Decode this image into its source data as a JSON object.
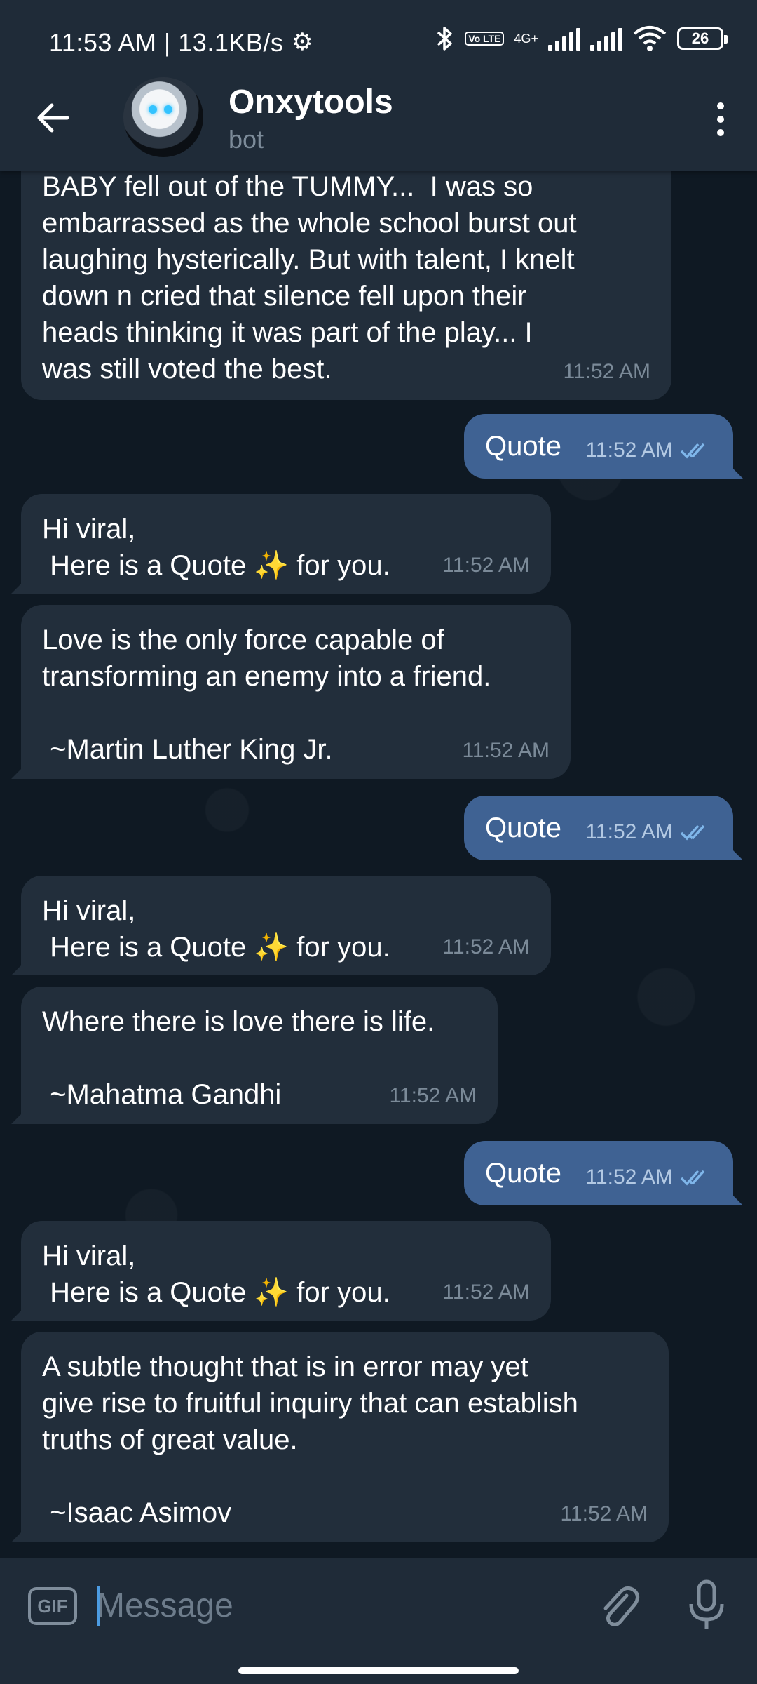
{
  "status_bar": {
    "time_speed": "11:53 AM | 13.1KB/s",
    "network": "4G+",
    "volte": "Vo LTE",
    "battery": "26"
  },
  "header": {
    "title": "Onxytools",
    "subtitle": "bot"
  },
  "messages": [
    {
      "dir": "in",
      "text": "BABY fell out of the TUMMY...  I was so\nembarrassed as the whole school burst out\nlaughing hysterically. But with talent, I knelt\ndown n cried that silence fell upon their\nheads thinking it was part of the play... I\nwas still voted the best.",
      "time": "11:52 AM"
    },
    {
      "dir": "out",
      "text": "Quote",
      "time": "11:52 AM"
    },
    {
      "dir": "in",
      "line1": "Hi viral,",
      "line2a": " Here is a Quote ",
      "sparkle": "✨",
      "line2b": " for you.",
      "time": "11:52 AM"
    },
    {
      "dir": "in",
      "text": "Love is the only force capable of\ntransforming an enemy into a friend.\n\n ~Martin Luther King Jr.",
      "time": "11:52 AM"
    },
    {
      "dir": "out",
      "text": "Quote",
      "time": "11:52 AM"
    },
    {
      "dir": "in",
      "line1": "Hi viral,",
      "line2a": " Here is a Quote ",
      "sparkle": "✨",
      "line2b": " for you.",
      "time": "11:52 AM"
    },
    {
      "dir": "in",
      "text": "Where there is love there is life.\n\n ~Mahatma Gandhi",
      "time": "11:52 AM"
    },
    {
      "dir": "out",
      "text": "Quote",
      "time": "11:52 AM"
    },
    {
      "dir": "in",
      "line1": "Hi viral,",
      "line2a": " Here is a Quote ",
      "sparkle": "✨",
      "line2b": " for you.",
      "time": "11:52 AM"
    },
    {
      "dir": "in",
      "text": "A subtle thought that is in error may yet\ngive rise to fruitful inquiry that can establish\ntruths of great value.\n\n ~Isaac Asimov",
      "time": "11:52 AM"
    }
  ],
  "composer": {
    "gif_label": "GIF",
    "placeholder": "Message"
  },
  "icons": {
    "back": "arrow-left-icon",
    "menu": "more-vertical-icon",
    "attach": "paperclip-icon",
    "mic": "microphone-icon",
    "read": "double-check-icon",
    "settings": "gear-icon"
  }
}
